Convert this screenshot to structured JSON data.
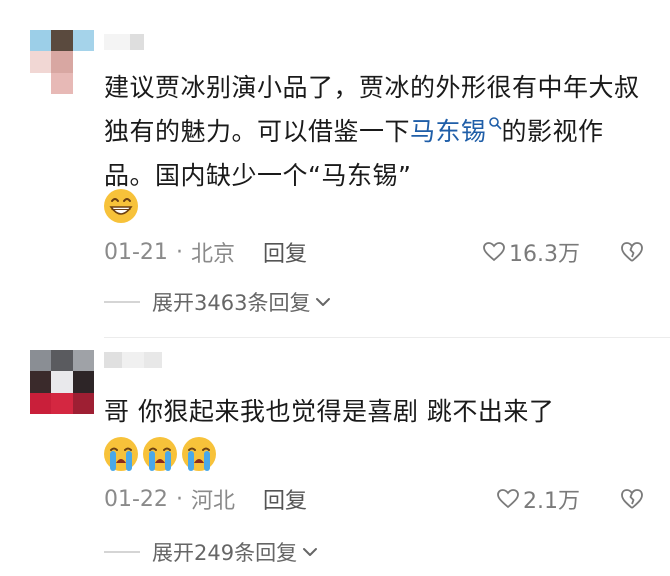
{
  "comments": [
    {
      "text_before": "建议贾冰别演小品了，贾冰的外形很有中年大叔独有的魅力。可以借鉴一下",
      "link": "马东锡",
      "text_after": "的影视作品。国内缺少一个“马东锡”",
      "emoji": "grinning-face",
      "date": "01-21",
      "separator": "·",
      "location": "北京",
      "reply_label": "回复",
      "likes": "16.3万",
      "expand_label": "展开3463条回复"
    },
    {
      "text_before": "哥 你狠起来我也觉得是喜剧 跳不出来了",
      "link": "",
      "text_after": "",
      "emoji": "loudly-crying-face",
      "date": "01-22",
      "separator": "·",
      "location": "河北",
      "reply_label": "回复",
      "likes": "2.1万",
      "expand_label": "展开249条回复"
    }
  ],
  "colors": {
    "link": "#1f5ea8",
    "meta": "#8a8a8a",
    "emoji_face": "#f7c23a"
  }
}
